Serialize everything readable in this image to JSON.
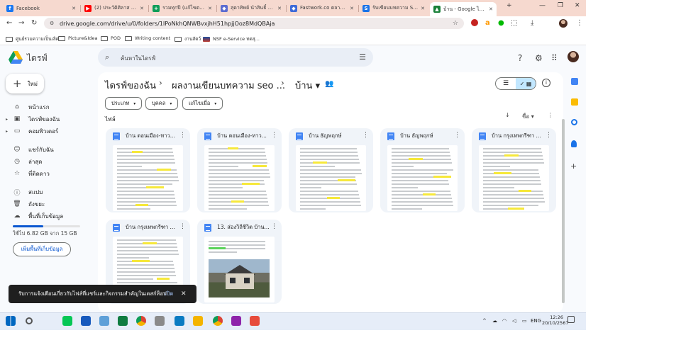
{
  "tabs": [
    {
      "title": "Facebook",
      "color": "#1877f2",
      "glyph": "f"
    },
    {
      "title": "(2) ประวัติศิลาส (ฐาน...",
      "color": "#ff0000",
      "glyph": "▶"
    },
    {
      "title": "รวมทุกปี (แก้ไขตามเพื่อ...",
      "color": "#0f9d58",
      "glyph": "+"
    },
    {
      "title": "สุดาทิพย์ นำสินธิ์ พรีเม...",
      "color": "#5b6bd0",
      "glyph": "◆"
    },
    {
      "title": "Fastwork.co ตลาดรวม...",
      "color": "#3f6ad8",
      "glyph": "◆"
    },
    {
      "title": "รับเขียนบทความ SEO ค...",
      "color": "#1a73e8",
      "glyph": "S"
    },
    {
      "title": "บ้าน - Google ไดรฟ์",
      "color": "#188038",
      "glyph": "▲"
    }
  ],
  "address": "drive.google.com/drive/u/0/folders/1IPoNkhQNWBvxjhH51hpjjOoz8MdQBAja",
  "bookmarks": [
    "ศูนย์รวมความเป็นเลิศ",
    "Picture&Idea",
    "POD",
    "Writing content",
    "งานสัตว์",
    "NSF e-Service ทดสุ..."
  ],
  "app": {
    "name": "ไดรฟ์",
    "new_label": "ใหม่",
    "search_placeholder": "ค้นหาในไดรฟ์"
  },
  "nav": [
    {
      "label": "หน้าแรก",
      "icon": "⌂",
      "name": "home"
    },
    {
      "label": "ไดรฟ์ของฉัน",
      "icon": "▣",
      "name": "my-drive"
    },
    {
      "label": "คอมพิวเตอร์",
      "icon": "▭",
      "name": "computers"
    },
    {
      "label": "แชร์กับฉัน",
      "icon": "☺",
      "name": "shared"
    },
    {
      "label": "ล่าสุด",
      "icon": "◷",
      "name": "recent"
    },
    {
      "label": "ที่ติดดาว",
      "icon": "☆",
      "name": "starred"
    },
    {
      "label": "สแปม",
      "icon": "ⓘ",
      "name": "spam"
    },
    {
      "label": "ถังขยะ",
      "icon": "🗑",
      "name": "trash"
    },
    {
      "label": "พื้นที่เก็บข้อมูล",
      "icon": "☁",
      "name": "storage"
    }
  ],
  "storage": {
    "text": "ใช้ไป 6.82 GB จาก 15 GB",
    "button": "เพิ่มพื้นที่เก็บข้อมูล",
    "fraction": 0.45
  },
  "breadcrumb": [
    "ไดรฟ์ของฉัน",
    "ผลงานเขียนบทความ seo ...",
    "บ้าน"
  ],
  "filters": [
    "ประเภท",
    "บุคคล",
    "แก้ไขเมื่อ"
  ],
  "section_label": "ไฟล์",
  "sort_label": "ชื่อ",
  "files": [
    {
      "name": "บ้าน ดอนเมือง-ทาว...",
      "kind": "text"
    },
    {
      "name": "บ้าน ดอนเมือง-ทาว...",
      "kind": "text"
    },
    {
      "name": "บ้าน ธัญพฤกษ์",
      "kind": "text"
    },
    {
      "name": "บ้าน ธัญพฤกษ์",
      "kind": "text"
    },
    {
      "name": "บ้าน กรุงเทพกรีฑา ...",
      "kind": "text"
    },
    {
      "name": "บ้าน กรุงเทพกรีฑา ...",
      "kind": "text"
    },
    {
      "name": "13. ส่องวิถีชีวิต บ้าน...",
      "kind": "image"
    }
  ],
  "toast": {
    "text": "รับการแจ้งเตือนเกี่ยวกับไฟล์ที่แชร์และกิจกรรมสำคัญในเดสก์ท็อป",
    "action": "เปิด"
  },
  "taskbar": {
    "time": "12:26",
    "date": "20/10/2567",
    "lang": "ENG"
  }
}
